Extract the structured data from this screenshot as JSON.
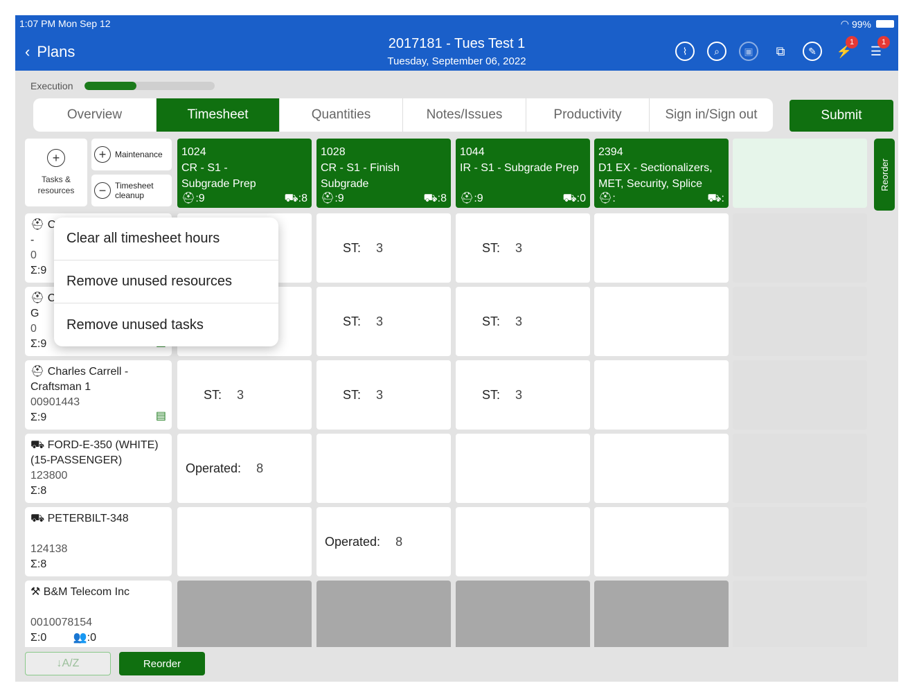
{
  "status": {
    "time": "1:07 PM  Mon Sep 12",
    "battery": "99%"
  },
  "header": {
    "back_label": "Plans",
    "title": "2017181 - Tues Test 1",
    "subtitle": "Tuesday, September 06, 2022",
    "icons": [
      "paperclip-icon",
      "search-icon",
      "document-icon",
      "add-copy-icon",
      "edit-icon",
      "notification-icon",
      "menu-icon"
    ],
    "badge_notifications": "1",
    "badge_menu": "1"
  },
  "execution": {
    "label": "Execution",
    "progress": 0.4
  },
  "tabs": [
    "Overview",
    "Timesheet",
    "Quantities",
    "Notes/Issues",
    "Productivity",
    "Sign in/Sign out"
  ],
  "submit_label": "Submit",
  "toolbar": {
    "tasks_resources": "Tasks & resources",
    "maintenance": "Maintenance",
    "timesheet_cleanup": "Timesheet cleanup"
  },
  "tasks": [
    {
      "code": "1024",
      "name": "CR - S1 - Subgrade Prep",
      "workers": "9",
      "equipment": "8"
    },
    {
      "code": "1028",
      "name": "CR - S1 - Finish Subgrade",
      "workers": "9",
      "equipment": "8"
    },
    {
      "code": "1044",
      "name": "IR - S1 - Subgrade Prep",
      "workers": "9",
      "equipment": "0"
    },
    {
      "code": "2394",
      "name": "D1 EX - Sectionalizers, MET, Security, Splice",
      "workers": "",
      "equipment": ""
    }
  ],
  "reorder_side": "Reorder",
  "resources": [
    {
      "line1": "C",
      "line2": "-",
      "code": "0",
      "sum": "9"
    },
    {
      "line1": "C",
      "line2": "G",
      "code": "0",
      "sum": "9"
    },
    {
      "line1": "Charles Carrell  -",
      "line2": "Craftsman 1",
      "code": "00901443",
      "sum": "9"
    },
    {
      "line1": "FORD-E-350 (WHITE)",
      "line2": "(15-PASSENGER)",
      "code": "123800",
      "sum": "8"
    },
    {
      "line1": "PETERBILT-348",
      "line2": "",
      "code": "124138",
      "sum": "8"
    },
    {
      "line1": "B&M Telecom Inc",
      "line2": "",
      "code": "0010078154",
      "sum": "0",
      "crew": "0"
    }
  ],
  "cells": {
    "st_label": "ST:",
    "operated_label": "Operated:",
    "st_value": "3",
    "operated_value": "8"
  },
  "popup": [
    "Clear all timesheet hours",
    "Remove unused resources",
    "Remove unused tasks"
  ],
  "bottom": {
    "sort": "↓A/Z",
    "reorder": "Reorder"
  }
}
